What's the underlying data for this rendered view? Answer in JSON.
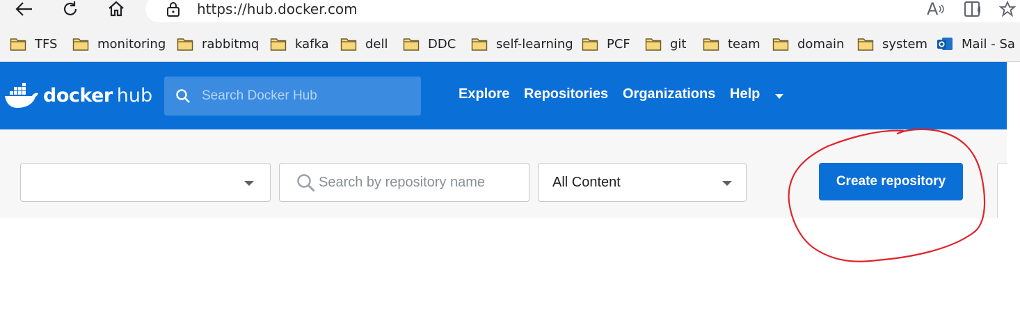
{
  "browser": {
    "url": "https://hub.docker.com",
    "icons": [
      "back-arrow-icon",
      "refresh-icon",
      "home-icon",
      "lock-icon",
      "read-aloud-icon",
      "immersive-reader-icon",
      "favorite-star-icon"
    ],
    "read_aloud_glyph": "A"
  },
  "bookmarks": [
    {
      "label": "TFS",
      "icon": "folder-icon"
    },
    {
      "label": "monitoring",
      "icon": "folder-icon"
    },
    {
      "label": "rabbitmq",
      "icon": "folder-icon"
    },
    {
      "label": "kafka",
      "icon": "folder-icon"
    },
    {
      "label": "dell",
      "icon": "folder-icon"
    },
    {
      "label": "DDC",
      "icon": "folder-icon"
    },
    {
      "label": "self-learning",
      "icon": "folder-icon"
    },
    {
      "label": "PCF",
      "icon": "folder-icon"
    },
    {
      "label": "git",
      "icon": "folder-icon"
    },
    {
      "label": "team",
      "icon": "folder-icon"
    },
    {
      "label": "domain",
      "icon": "folder-icon"
    },
    {
      "label": "system",
      "icon": "folder-icon"
    },
    {
      "label": "Mail - Sa",
      "icon": "outlook-icon"
    }
  ],
  "header": {
    "logo_docker": "docker",
    "logo_hub": "hub",
    "search_placeholder": "Search Docker Hub",
    "nav": [
      "Explore",
      "Repositories",
      "Organizations",
      "Help"
    ]
  },
  "filters": {
    "namespace_value": "",
    "repo_search_placeholder": "Search by repository name",
    "content_filter_value": "All Content"
  },
  "actions": {
    "create_repository_label": "Create repository"
  },
  "colors": {
    "brand_blue": "#0b6fd8",
    "annotation_red": "#e0242b",
    "folder_yellow": "#f7d77a"
  }
}
